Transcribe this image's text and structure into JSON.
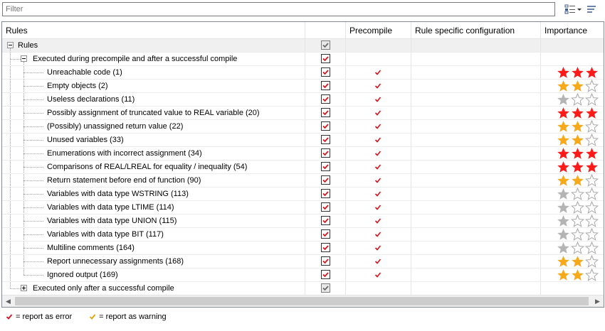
{
  "filter": {
    "placeholder": "Filter",
    "value": ""
  },
  "toolbar": {
    "options_icon": "view-options-icon",
    "wrap_icon": "wrap-text-icon"
  },
  "columns": {
    "rules": "Rules",
    "enabled": "",
    "precompile": "Precompile",
    "config": "Rule specific configuration",
    "importance": "Importance"
  },
  "colors": {
    "check_red": "#d9141c",
    "check_orange": "#e6a100",
    "star_red": "#ff1a1a",
    "star_orange": "#f5a91b",
    "star_grey": "#b4b4b4"
  },
  "tree": {
    "root": {
      "label": "Rules",
      "checked": "indeterminate",
      "expanded": true
    },
    "group1": {
      "label": "Executed during precompile and after a successful compile",
      "checked": true,
      "expanded": true
    },
    "group2": {
      "label": "Executed only after a successful compile",
      "checked": "indeterminate",
      "expanded": false
    }
  },
  "rules": [
    {
      "label": "Unreachable code (1)",
      "checked": true,
      "precompile": true,
      "importance": 3,
      "level": "error"
    },
    {
      "label": "Empty objects (2)",
      "checked": true,
      "precompile": true,
      "importance": 2,
      "level": "warning"
    },
    {
      "label": "Useless declarations (11)",
      "checked": true,
      "precompile": true,
      "importance": 1,
      "level": "info"
    },
    {
      "label": "Possibly assignment of truncated value to REAL variable (20)",
      "checked": true,
      "precompile": true,
      "importance": 3,
      "level": "error"
    },
    {
      "label": "(Possibly) unassigned return value (22)",
      "checked": true,
      "precompile": true,
      "importance": 2,
      "level": "warning"
    },
    {
      "label": "Unused variables (33)",
      "checked": true,
      "precompile": true,
      "importance": 2,
      "level": "warning"
    },
    {
      "label": "Enumerations with incorrect assignment (34)",
      "checked": true,
      "precompile": true,
      "importance": 3,
      "level": "error"
    },
    {
      "label": "Comparisons of REAL/LREAL for equality / inequality (54)",
      "checked": true,
      "precompile": true,
      "importance": 3,
      "level": "error"
    },
    {
      "label": "Return statement before end of function (90)",
      "checked": true,
      "precompile": true,
      "importance": 2,
      "level": "warning"
    },
    {
      "label": "Variables with data type WSTRING (113)",
      "checked": true,
      "precompile": true,
      "importance": 1,
      "level": "info"
    },
    {
      "label": "Variables with data type LTIME (114)",
      "checked": true,
      "precompile": true,
      "importance": 1,
      "level": "info"
    },
    {
      "label": "Variables with data type UNION (115)",
      "checked": true,
      "precompile": true,
      "importance": 1,
      "level": "info"
    },
    {
      "label": "Variables with data type BIT (117)",
      "checked": true,
      "precompile": true,
      "importance": 1,
      "level": "info"
    },
    {
      "label": "Multiline comments (164)",
      "checked": true,
      "precompile": true,
      "importance": 1,
      "level": "info"
    },
    {
      "label": "Report unnecessary assignments (168)",
      "checked": true,
      "precompile": true,
      "importance": 2,
      "level": "warning"
    },
    {
      "label": "Ignored output (169)",
      "checked": true,
      "precompile": true,
      "importance": 2,
      "level": "warning"
    }
  ],
  "legend": {
    "error_text": "= report as error",
    "warning_text": "= report as warning"
  }
}
